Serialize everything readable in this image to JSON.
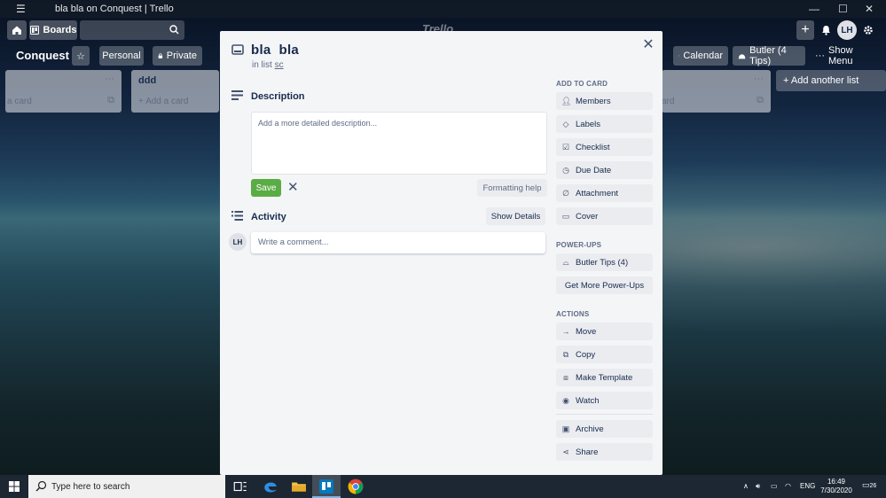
{
  "window": {
    "title": "bla bla on Conquest | Trello"
  },
  "header": {
    "boards_label": "Boards",
    "logo": "Trello",
    "avatar": "LH"
  },
  "board": {
    "name": "Conquest",
    "personal_label": "Personal",
    "private_label": "Private",
    "calendar_label": "Calendar",
    "butler_label": "Butler (4 Tips)",
    "show_menu_label": "Show Menu",
    "add_list_label": "+ Add another list"
  },
  "lists": [
    {
      "title": "",
      "add_label": "a card"
    },
    {
      "title": "ddd",
      "add_label": "+ Add a card"
    },
    {
      "title": "",
      "add_label": "ard"
    }
  ],
  "card": {
    "title": "bla  bla",
    "in_list_prefix": "in list",
    "list_name": "sc",
    "description_heading": "Description",
    "description_placeholder": "Add a more detailed description...",
    "save_label": "Save",
    "formatting_help_label": "Formatting help",
    "activity_heading": "Activity",
    "show_details_label": "Show Details",
    "comment_avatar": "LH",
    "comment_placeholder": "Write a comment..."
  },
  "sidebar": {
    "add_to_card_heading": "ADD TO CARD",
    "add_to_card": [
      {
        "label": "Members",
        "icon": "person-icon"
      },
      {
        "label": "Labels",
        "icon": "label-icon"
      },
      {
        "label": "Checklist",
        "icon": "checklist-icon"
      },
      {
        "label": "Due Date",
        "icon": "clock-icon"
      },
      {
        "label": "Attachment",
        "icon": "paperclip-icon"
      },
      {
        "label": "Cover",
        "icon": "cover-icon"
      }
    ],
    "powerups_heading": "POWER-UPS",
    "butler_tips_label": "Butler Tips (4)",
    "get_more_label": "Get More Power-Ups",
    "actions_heading": "ACTIONS",
    "actions": [
      {
        "label": "Move",
        "icon": "arrow-right-icon"
      },
      {
        "label": "Copy",
        "icon": "copy-icon"
      },
      {
        "label": "Make Template",
        "icon": "template-icon"
      },
      {
        "label": "Watch",
        "icon": "eye-icon"
      }
    ],
    "archive_label": "Archive",
    "share_label": "Share"
  },
  "taskbar": {
    "search_placeholder": "Type here to search",
    "language": "ENG",
    "time": "16:49",
    "date": "7/30/2020",
    "notification_count": "26"
  }
}
